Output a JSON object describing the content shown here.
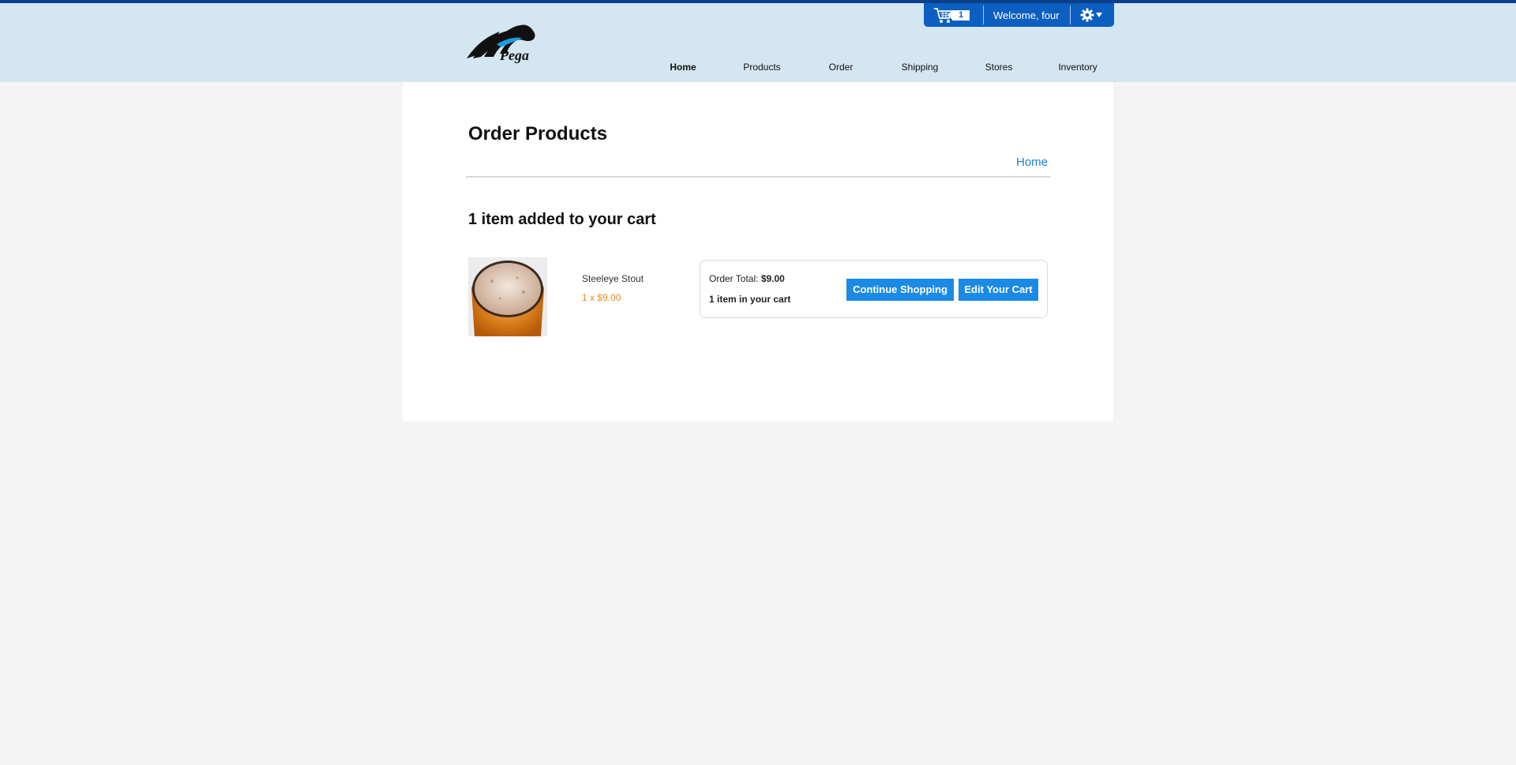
{
  "header": {
    "logo_text": "Pega",
    "cart_count": "1",
    "welcome": "Welcome, four"
  },
  "nav": {
    "items": [
      {
        "label": "Home",
        "active": true
      },
      {
        "label": "Products"
      },
      {
        "label": "Order"
      },
      {
        "label": "Shipping"
      },
      {
        "label": "Stores"
      },
      {
        "label": "Inventory"
      }
    ]
  },
  "page": {
    "title": "Order Products",
    "breadcrumb": "Home",
    "added_message": "1 item added to your cart"
  },
  "product": {
    "name": "Steeleye Stout",
    "quantity_price": "1 x $9.00"
  },
  "summary": {
    "order_total_label": "Order Total:",
    "order_total_value": "$9.00",
    "items_in_cart": "1 item in your cart",
    "continue_label": "Continue Shopping",
    "edit_label": "Edit Your Cart"
  },
  "colors": {
    "header_bg": "#d4e6f2",
    "userbar_bg": "#0c5fc0",
    "button_bg": "#1a8ae6",
    "link": "#1a7fd6",
    "price_orange": "#e88a1a"
  },
  "icons": {
    "cart": "cart-icon",
    "settings": "gear-icon",
    "dropdown": "chevron-down-icon"
  }
}
